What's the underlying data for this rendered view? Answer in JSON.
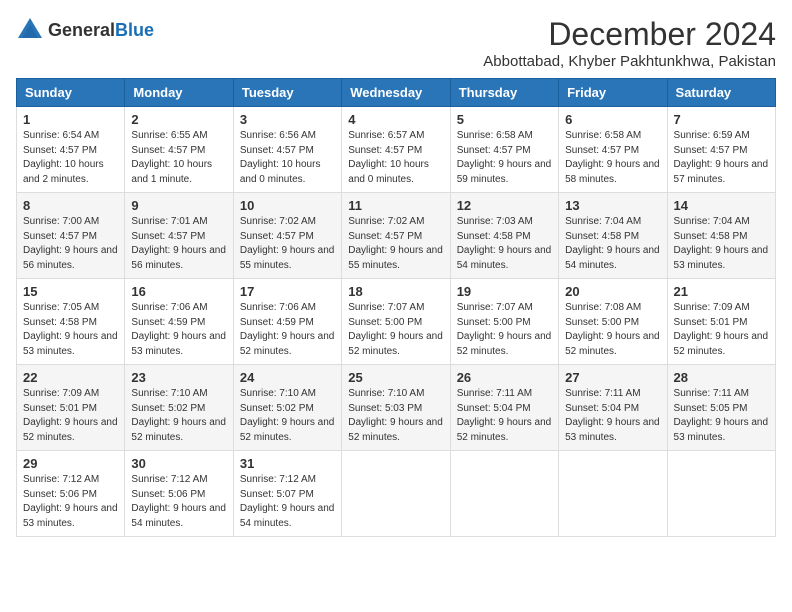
{
  "header": {
    "logo_general": "General",
    "logo_blue": "Blue",
    "month_title": "December 2024",
    "subtitle": "Abbottabad, Khyber Pakhtunkhwa, Pakistan"
  },
  "days_of_week": [
    "Sunday",
    "Monday",
    "Tuesday",
    "Wednesday",
    "Thursday",
    "Friday",
    "Saturday"
  ],
  "weeks": [
    [
      {
        "day": "1",
        "sunrise": "6:54 AM",
        "sunset": "4:57 PM",
        "daylight": "10 hours and 2 minutes"
      },
      {
        "day": "2",
        "sunrise": "6:55 AM",
        "sunset": "4:57 PM",
        "daylight": "10 hours and 1 minute"
      },
      {
        "day": "3",
        "sunrise": "6:56 AM",
        "sunset": "4:57 PM",
        "daylight": "10 hours and 0 minutes"
      },
      {
        "day": "4",
        "sunrise": "6:57 AM",
        "sunset": "4:57 PM",
        "daylight": "10 hours and 0 minutes"
      },
      {
        "day": "5",
        "sunrise": "6:58 AM",
        "sunset": "4:57 PM",
        "daylight": "9 hours and 59 minutes"
      },
      {
        "day": "6",
        "sunrise": "6:58 AM",
        "sunset": "4:57 PM",
        "daylight": "9 hours and 58 minutes"
      },
      {
        "day": "7",
        "sunrise": "6:59 AM",
        "sunset": "4:57 PM",
        "daylight": "9 hours and 57 minutes"
      }
    ],
    [
      {
        "day": "8",
        "sunrise": "7:00 AM",
        "sunset": "4:57 PM",
        "daylight": "9 hours and 56 minutes"
      },
      {
        "day": "9",
        "sunrise": "7:01 AM",
        "sunset": "4:57 PM",
        "daylight": "9 hours and 56 minutes"
      },
      {
        "day": "10",
        "sunrise": "7:02 AM",
        "sunset": "4:57 PM",
        "daylight": "9 hours and 55 minutes"
      },
      {
        "day": "11",
        "sunrise": "7:02 AM",
        "sunset": "4:57 PM",
        "daylight": "9 hours and 55 minutes"
      },
      {
        "day": "12",
        "sunrise": "7:03 AM",
        "sunset": "4:58 PM",
        "daylight": "9 hours and 54 minutes"
      },
      {
        "day": "13",
        "sunrise": "7:04 AM",
        "sunset": "4:58 PM",
        "daylight": "9 hours and 54 minutes"
      },
      {
        "day": "14",
        "sunrise": "7:04 AM",
        "sunset": "4:58 PM",
        "daylight": "9 hours and 53 minutes"
      }
    ],
    [
      {
        "day": "15",
        "sunrise": "7:05 AM",
        "sunset": "4:58 PM",
        "daylight": "9 hours and 53 minutes"
      },
      {
        "day": "16",
        "sunrise": "7:06 AM",
        "sunset": "4:59 PM",
        "daylight": "9 hours and 53 minutes"
      },
      {
        "day": "17",
        "sunrise": "7:06 AM",
        "sunset": "4:59 PM",
        "daylight": "9 hours and 52 minutes"
      },
      {
        "day": "18",
        "sunrise": "7:07 AM",
        "sunset": "5:00 PM",
        "daylight": "9 hours and 52 minutes"
      },
      {
        "day": "19",
        "sunrise": "7:07 AM",
        "sunset": "5:00 PM",
        "daylight": "9 hours and 52 minutes"
      },
      {
        "day": "20",
        "sunrise": "7:08 AM",
        "sunset": "5:00 PM",
        "daylight": "9 hours and 52 minutes"
      },
      {
        "day": "21",
        "sunrise": "7:09 AM",
        "sunset": "5:01 PM",
        "daylight": "9 hours and 52 minutes"
      }
    ],
    [
      {
        "day": "22",
        "sunrise": "7:09 AM",
        "sunset": "5:01 PM",
        "daylight": "9 hours and 52 minutes"
      },
      {
        "day": "23",
        "sunrise": "7:10 AM",
        "sunset": "5:02 PM",
        "daylight": "9 hours and 52 minutes"
      },
      {
        "day": "24",
        "sunrise": "7:10 AM",
        "sunset": "5:02 PM",
        "daylight": "9 hours and 52 minutes"
      },
      {
        "day": "25",
        "sunrise": "7:10 AM",
        "sunset": "5:03 PM",
        "daylight": "9 hours and 52 minutes"
      },
      {
        "day": "26",
        "sunrise": "7:11 AM",
        "sunset": "5:04 PM",
        "daylight": "9 hours and 52 minutes"
      },
      {
        "day": "27",
        "sunrise": "7:11 AM",
        "sunset": "5:04 PM",
        "daylight": "9 hours and 53 minutes"
      },
      {
        "day": "28",
        "sunrise": "7:11 AM",
        "sunset": "5:05 PM",
        "daylight": "9 hours and 53 minutes"
      }
    ],
    [
      {
        "day": "29",
        "sunrise": "7:12 AM",
        "sunset": "5:06 PM",
        "daylight": "9 hours and 53 minutes"
      },
      {
        "day": "30",
        "sunrise": "7:12 AM",
        "sunset": "5:06 PM",
        "daylight": "9 hours and 54 minutes"
      },
      {
        "day": "31",
        "sunrise": "7:12 AM",
        "sunset": "5:07 PM",
        "daylight": "9 hours and 54 minutes"
      },
      null,
      null,
      null,
      null
    ]
  ],
  "labels": {
    "sunrise": "Sunrise:",
    "sunset": "Sunset:",
    "daylight": "Daylight hours"
  }
}
